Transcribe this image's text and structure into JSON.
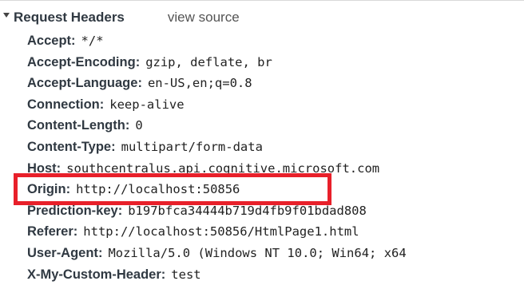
{
  "section": {
    "title": "Request Headers",
    "view_source_label": "view source",
    "toggle_icon": "triangle-down-icon"
  },
  "headers": [
    {
      "name": "Accept",
      "value": "*/*"
    },
    {
      "name": "Accept-Encoding",
      "value": "gzip, deflate, br"
    },
    {
      "name": "Accept-Language",
      "value": "en-US,en;q=0.8"
    },
    {
      "name": "Connection",
      "value": "keep-alive"
    },
    {
      "name": "Content-Length",
      "value": "0"
    },
    {
      "name": "Content-Type",
      "value": "multipart/form-data"
    },
    {
      "name": "Host",
      "value": "southcentralus.api.cognitive.microsoft.com"
    },
    {
      "name": "Origin",
      "value": "http://localhost:50856"
    },
    {
      "name": "Prediction-key",
      "value": "b197bfca34444b719d4fb9f01bdad808"
    },
    {
      "name": "Referer",
      "value": "http://localhost:50856/HtmlPage1.html"
    },
    {
      "name": "User-Agent",
      "value": "Mozilla/5.0 (Windows NT 10.0; Win64; x64"
    },
    {
      "name": "X-My-Custom-Header",
      "value": "test"
    }
  ],
  "separator": ":",
  "colors": {
    "highlight": "#e8202a",
    "header_name": "#303942",
    "value_text": "#222222"
  }
}
